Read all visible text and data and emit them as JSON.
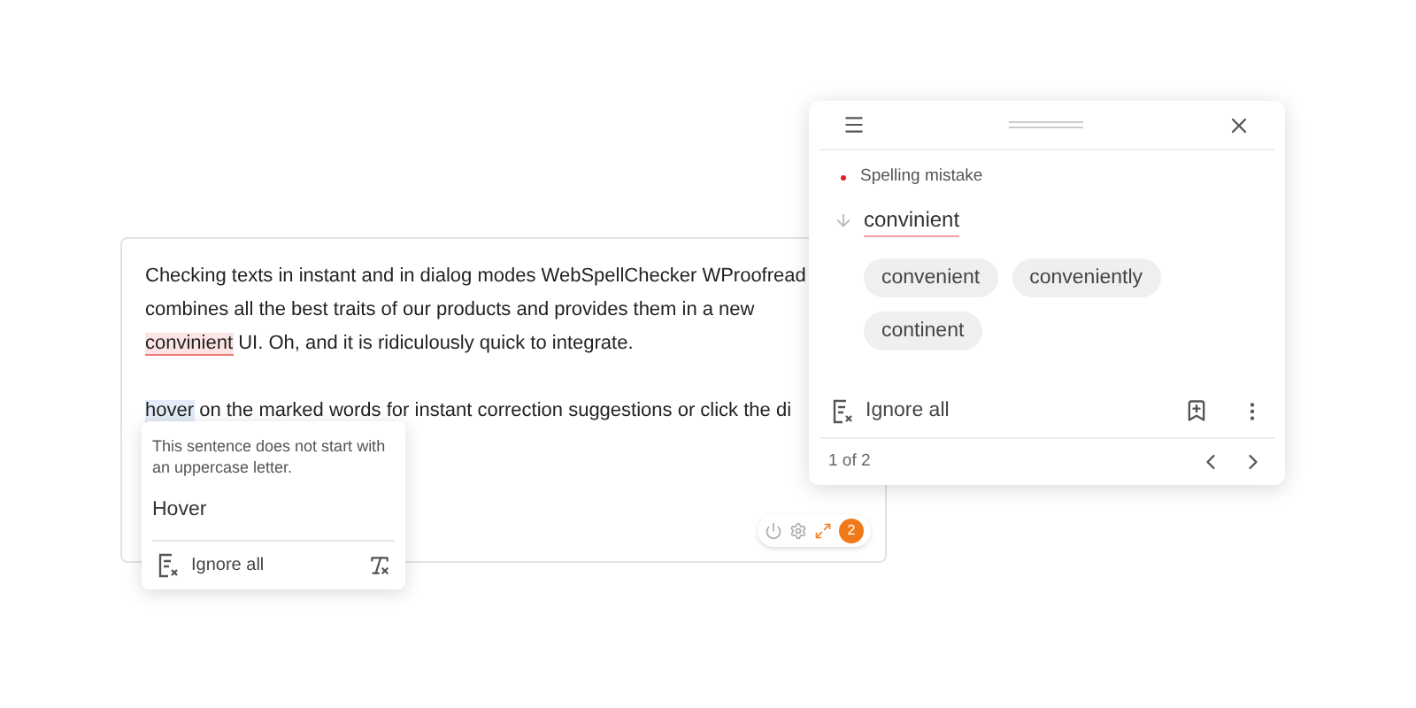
{
  "editor": {
    "paragraphs": [
      {
        "lines": [
          [
            {
              "text": "Checking texts in instant and in dialog modes WebSpellChecker WProofread"
            }
          ],
          [
            {
              "text": "combines all the best traits of our products and provides them in a new"
            }
          ],
          [
            {
              "text": "convinient",
              "kind": "spelling"
            },
            {
              "text": " UI. Oh, and it is ridiculously quick to integrate."
            }
          ]
        ]
      },
      {
        "lines": [
          [
            {
              "text": "hover",
              "kind": "grammar"
            },
            {
              "text": " on the marked words for instant correction suggestions or click the di"
            }
          ]
        ]
      }
    ],
    "badge": {
      "count": "2"
    }
  },
  "tooltip": {
    "message": "This sentence does not start with an uppercase letter.",
    "suggestion": "Hover",
    "ignore": "Ignore all"
  },
  "panel": {
    "category": "Spelling mistake",
    "word": "convinient",
    "suggestions": [
      {
        "text": "convenient"
      },
      {
        "text": "conveniently"
      },
      {
        "text": "continent"
      }
    ],
    "ignore": "Ignore all",
    "pager": "1 of 2"
  }
}
